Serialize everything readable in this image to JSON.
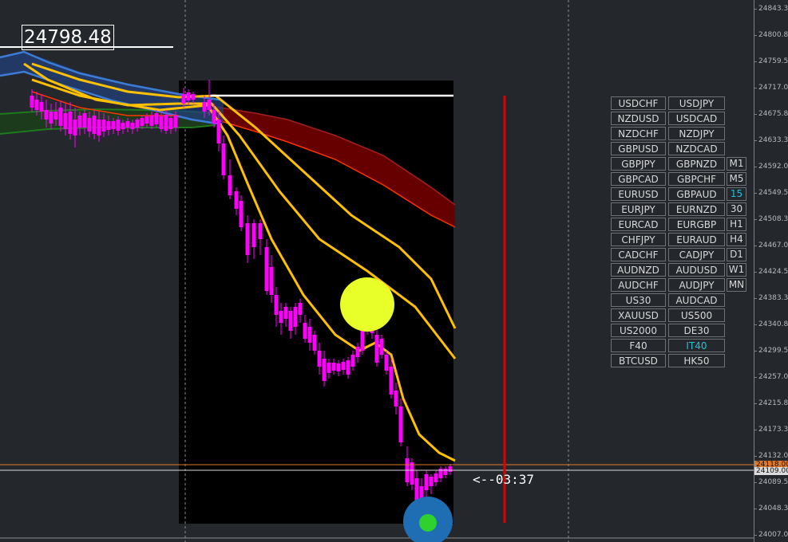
{
  "chart": {
    "current_price_label": "24798.48",
    "countdown": "<--03:37",
    "y_axis_ticks": [
      "24843.30",
      "24800.80",
      "24759.55",
      "24717.05",
      "24675.80",
      "24633.30",
      "24592.05",
      "24549.55",
      "24508.30",
      "24467.05",
      "24424.55",
      "24383.30",
      "24340.80",
      "24299.55",
      "24257.05",
      "24215.80",
      "24173.30",
      "24132.05",
      "24089.55",
      "24048.30",
      "24007.05"
    ],
    "bid_tag": "24118.00",
    "ask_tag": "24109.00",
    "colors": {
      "background": "#24272b",
      "session_box": "#000000",
      "candles": "#ff00ff",
      "ma_yellow": "#ffc000",
      "ma_red": "#ff3300",
      "cloud": "#6b0000",
      "blue_ma": "#3c7cd6",
      "green_ma": "#1d7a1d",
      "signal_circle": "#e8ff2a",
      "blue_circle": "#1f6db3",
      "green_dot": "#2ed12e",
      "red_marker": "#dd0000",
      "price_line_orange": "#e07a2a"
    }
  },
  "symbols": [
    [
      "USDCHF",
      "USDJPY"
    ],
    [
      "NZDUSD",
      "USDCAD"
    ],
    [
      "NZDCHF",
      "NZDJPY"
    ],
    [
      "GBPUSD",
      "NZDCAD"
    ],
    [
      "GBPJPY",
      "GBPNZD"
    ],
    [
      "GBPCAD",
      "GBPCHF"
    ],
    [
      "EURUSD",
      "GBPAUD"
    ],
    [
      "EURJPY",
      "EURNZD"
    ],
    [
      "EURCAD",
      "EURGBP"
    ],
    [
      "CHFJPY",
      "EURAUD"
    ],
    [
      "CADCHF",
      "CADJPY"
    ],
    [
      "AUDNZD",
      "AUDUSD"
    ],
    [
      "AUDCHF",
      "AUDJPY"
    ],
    [
      "US30",
      "AUDCAD"
    ],
    [
      "XAUUSD",
      "US500"
    ],
    [
      "US2000",
      "DE30"
    ],
    [
      "F40",
      "IT40"
    ],
    [
      "BTCUSD",
      "HK50"
    ]
  ],
  "active_symbol": "IT40",
  "timeframes": [
    "M1",
    "M5",
    "15",
    "30",
    "H1",
    "H4",
    "D1",
    "W1",
    "MN"
  ],
  "active_timeframe": "15"
}
